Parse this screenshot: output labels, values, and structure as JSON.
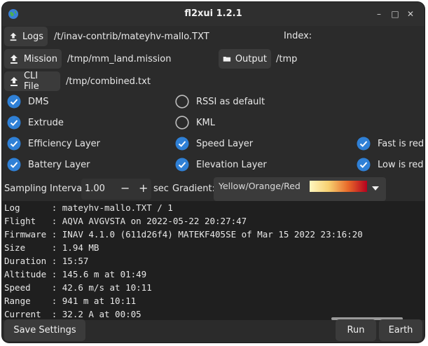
{
  "window": {
    "title": "fl2xui 1.2.1",
    "minimize": "–",
    "maximize": "□",
    "close": "✕"
  },
  "files": {
    "logs_label": "Logs",
    "logs_value": "/t/inav-contrib/mateyhv-mallo.TXT",
    "index_label": "Index:",
    "mission_label": "Mission",
    "mission_value": "/tmp/mm_land.mission",
    "output_label": "Output",
    "output_value": "/tmp",
    "cli_label": "CLI File",
    "cli_value": "/tmp/combined.txt"
  },
  "options": {
    "dms": "DMS",
    "rssi": "RSSI as default",
    "extrude": "Extrude",
    "kml": "KML",
    "efficiency": "Efficiency Layer",
    "speed": "Speed Layer",
    "fast_red": "Fast is red",
    "battery": "Battery Layer",
    "elevation": "Elevation Layer",
    "low_red": "Low is red"
  },
  "sampling": {
    "label": "Sampling Interval",
    "value": "1.00",
    "minus": "−",
    "plus": "+",
    "unit": "sec",
    "gradient_label": "Gradient:",
    "gradient_value": "Yellow/Orange/Red"
  },
  "log_lines": [
    "Log      : mateyhv-mallo.TXT / 1",
    "Flight   : AQVA AVGVSTA on 2022-05-22 20:27:47",
    "Firmware : INAV 4.1.0 (611d26f4) MATEKF405SE of Mar 15 2022 23:16:20",
    "Size     : 1.94 MB",
    "Duration : 15:57",
    "Altitude : 145.6 m at 01:49",
    "Speed    : 42.6 m/s at 10:11",
    "Range    : 941 m at 10:11",
    "Current  : 32.2 A at 00:05"
  ],
  "actions": {
    "save": "Save Settings",
    "run": "Run",
    "earth": "Earth"
  },
  "colors": {
    "accent": "#2f80d6",
    "background": "#2b2b2b"
  }
}
